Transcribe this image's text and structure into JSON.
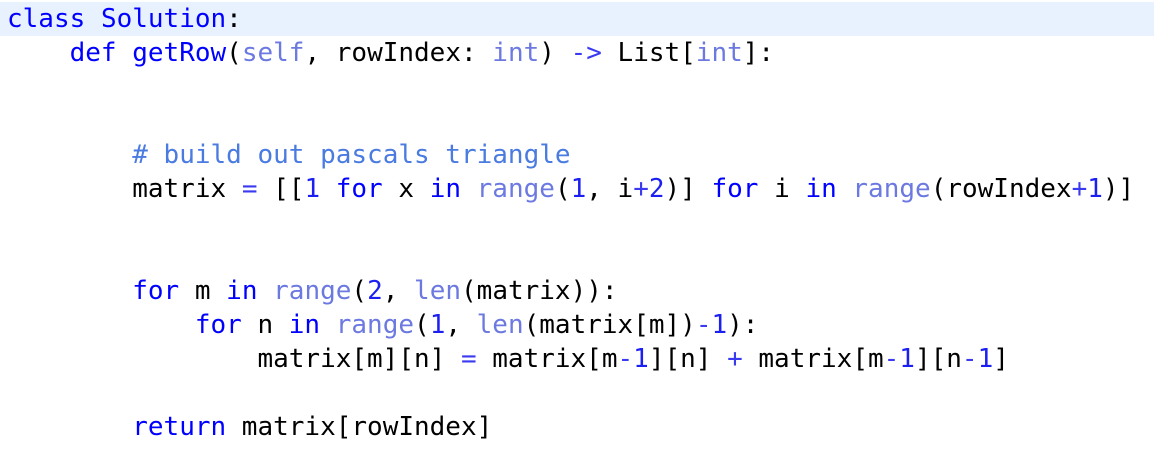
{
  "editor": {
    "colors": {
      "background": "#ffffff",
      "current_line_highlight": "#e8f2fe",
      "keyword": "#0000ff",
      "builtin": "#6c79e0",
      "number": "#1b1ff1",
      "operator": "#3a3af0",
      "comment": "#4a7be0",
      "text": "#000000"
    },
    "lines": [
      {
        "current": true,
        "tokens": [
          {
            "t": "kw",
            "v": "class"
          },
          {
            "t": "tx",
            "v": " "
          },
          {
            "t": "kw",
            "v": "Solution"
          },
          {
            "t": "tx",
            "v": ":"
          }
        ]
      },
      {
        "tokens": [
          {
            "t": "tx",
            "v": "    "
          },
          {
            "t": "kw",
            "v": "def"
          },
          {
            "t": "tx",
            "v": " "
          },
          {
            "t": "kw",
            "v": "getRow"
          },
          {
            "t": "tx",
            "v": "("
          },
          {
            "t": "bi",
            "v": "self"
          },
          {
            "t": "tx",
            "v": ", rowIndex: "
          },
          {
            "t": "bi",
            "v": "int"
          },
          {
            "t": "tx",
            "v": ") "
          },
          {
            "t": "op",
            "v": "->"
          },
          {
            "t": "tx",
            "v": " List["
          },
          {
            "t": "bi",
            "v": "int"
          },
          {
            "t": "tx",
            "v": "]:"
          }
        ]
      },
      {
        "tokens": []
      },
      {
        "tokens": []
      },
      {
        "tokens": [
          {
            "t": "tx",
            "v": "        "
          },
          {
            "t": "cm",
            "v": "# build out pascals triangle"
          }
        ]
      },
      {
        "tokens": [
          {
            "t": "tx",
            "v": "        matrix "
          },
          {
            "t": "op",
            "v": "="
          },
          {
            "t": "tx",
            "v": " [["
          },
          {
            "t": "num",
            "v": "1"
          },
          {
            "t": "tx",
            "v": " "
          },
          {
            "t": "kw",
            "v": "for"
          },
          {
            "t": "tx",
            "v": " x "
          },
          {
            "t": "kw",
            "v": "in"
          },
          {
            "t": "tx",
            "v": " "
          },
          {
            "t": "bi",
            "v": "range"
          },
          {
            "t": "tx",
            "v": "("
          },
          {
            "t": "num",
            "v": "1"
          },
          {
            "t": "tx",
            "v": ", i"
          },
          {
            "t": "op",
            "v": "+"
          },
          {
            "t": "num",
            "v": "2"
          },
          {
            "t": "tx",
            "v": ")] "
          },
          {
            "t": "kw",
            "v": "for"
          },
          {
            "t": "tx",
            "v": " i "
          },
          {
            "t": "kw",
            "v": "in"
          },
          {
            "t": "tx",
            "v": " "
          },
          {
            "t": "bi",
            "v": "range"
          },
          {
            "t": "tx",
            "v": "(rowIndex"
          },
          {
            "t": "op",
            "v": "+"
          },
          {
            "t": "num",
            "v": "1"
          },
          {
            "t": "tx",
            "v": ")]"
          }
        ]
      },
      {
        "tokens": []
      },
      {
        "tokens": []
      },
      {
        "tokens": [
          {
            "t": "tx",
            "v": "        "
          },
          {
            "t": "kw",
            "v": "for"
          },
          {
            "t": "tx",
            "v": " m "
          },
          {
            "t": "kw",
            "v": "in"
          },
          {
            "t": "tx",
            "v": " "
          },
          {
            "t": "bi",
            "v": "range"
          },
          {
            "t": "tx",
            "v": "("
          },
          {
            "t": "num",
            "v": "2"
          },
          {
            "t": "tx",
            "v": ", "
          },
          {
            "t": "bi",
            "v": "len"
          },
          {
            "t": "tx",
            "v": "(matrix)):"
          }
        ]
      },
      {
        "tokens": [
          {
            "t": "tx",
            "v": "            "
          },
          {
            "t": "kw",
            "v": "for"
          },
          {
            "t": "tx",
            "v": " n "
          },
          {
            "t": "kw",
            "v": "in"
          },
          {
            "t": "tx",
            "v": " "
          },
          {
            "t": "bi",
            "v": "range"
          },
          {
            "t": "tx",
            "v": "("
          },
          {
            "t": "num",
            "v": "1"
          },
          {
            "t": "tx",
            "v": ", "
          },
          {
            "t": "bi",
            "v": "len"
          },
          {
            "t": "tx",
            "v": "(matrix[m])"
          },
          {
            "t": "op",
            "v": "-"
          },
          {
            "t": "num",
            "v": "1"
          },
          {
            "t": "tx",
            "v": "):"
          }
        ]
      },
      {
        "tokens": [
          {
            "t": "tx",
            "v": "                matrix[m][n] "
          },
          {
            "t": "op",
            "v": "="
          },
          {
            "t": "tx",
            "v": " matrix[m"
          },
          {
            "t": "op",
            "v": "-"
          },
          {
            "t": "num",
            "v": "1"
          },
          {
            "t": "tx",
            "v": "][n] "
          },
          {
            "t": "op",
            "v": "+"
          },
          {
            "t": "tx",
            "v": " matrix[m"
          },
          {
            "t": "op",
            "v": "-"
          },
          {
            "t": "num",
            "v": "1"
          },
          {
            "t": "tx",
            "v": "][n"
          },
          {
            "t": "op",
            "v": "-"
          },
          {
            "t": "num",
            "v": "1"
          },
          {
            "t": "tx",
            "v": "]"
          }
        ]
      },
      {
        "tokens": []
      },
      {
        "tokens": [
          {
            "t": "tx",
            "v": "        "
          },
          {
            "t": "kw",
            "v": "return"
          },
          {
            "t": "tx",
            "v": " matrix[rowIndex]"
          }
        ]
      }
    ]
  }
}
